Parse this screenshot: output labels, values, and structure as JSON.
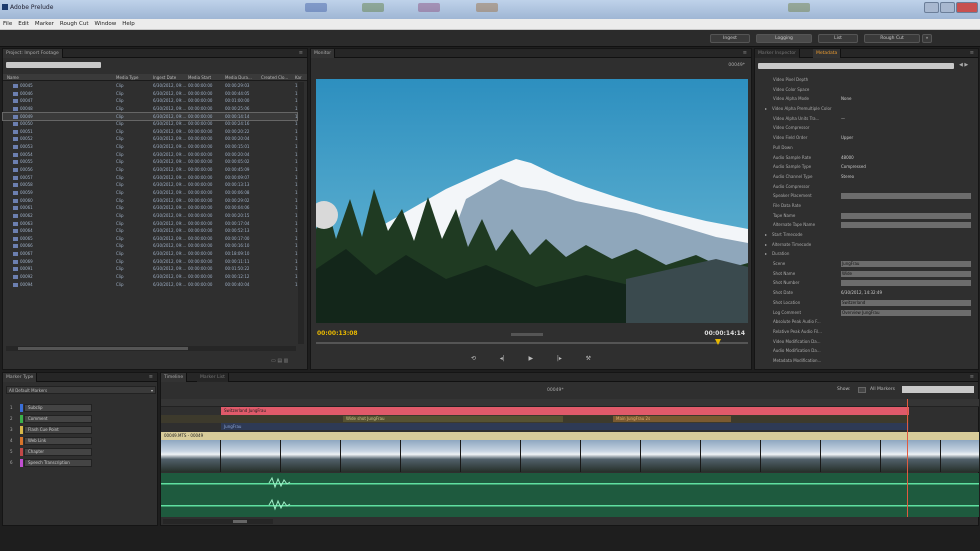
{
  "window": {
    "title": "Adobe Prelude",
    "menu": [
      "File",
      "Edit",
      "Marker",
      "Rough Cut",
      "Window",
      "Help"
    ]
  },
  "workspace": {
    "buttons": [
      "Ingest",
      "Logging",
      "List",
      "Rough Cut"
    ],
    "active": "Logging",
    "more": "»"
  },
  "project": {
    "tab": "Project: Import Footage",
    "menu_glyph": "≡",
    "columns": [
      "Name",
      "Media Type",
      "Ingest Date",
      "Media Start",
      "Media Dura...",
      "Created Clo...",
      "Kar"
    ],
    "rows": [
      {
        "name": "00045",
        "type": "Clip",
        "date": "6/30/2012, 09:...",
        "start": "00:00:00:00",
        "dur": "00:00:29:03"
      },
      {
        "name": "00046",
        "type": "Clip",
        "date": "6/30/2012, 09:...",
        "start": "00:00:00:00",
        "dur": "00:00:44:05"
      },
      {
        "name": "00047",
        "type": "Clip",
        "date": "6/30/2012, 09:...",
        "start": "00:00:00:00",
        "dur": "00:01:00:00"
      },
      {
        "name": "00048",
        "type": "Clip",
        "date": "6/30/2012, 09:...",
        "start": "00:00:00:00",
        "dur": "00:00:25:06"
      },
      {
        "name": "00049",
        "type": "Clip",
        "date": "6/30/2012, 09:...",
        "start": "00:00:00:00",
        "dur": "00:00:14:14"
      },
      {
        "name": "00050",
        "type": "Clip",
        "date": "6/30/2012, 09:...",
        "start": "00:00:00:00",
        "dur": "00:00:24:16"
      },
      {
        "name": "00051",
        "type": "Clip",
        "date": "6/30/2012, 09:...",
        "start": "00:00:00:00",
        "dur": "00:00:20:22"
      },
      {
        "name": "00052",
        "type": "Clip",
        "date": "6/30/2012, 09:...",
        "start": "00:00:00:00",
        "dur": "00:00:20:04"
      },
      {
        "name": "00053",
        "type": "Clip",
        "date": "6/30/2012, 09:...",
        "start": "00:00:00:00",
        "dur": "00:00:15:01"
      },
      {
        "name": "00054",
        "type": "Clip",
        "date": "6/30/2012, 09:...",
        "start": "00:00:00:00",
        "dur": "00:00:20:04"
      },
      {
        "name": "00055",
        "type": "Clip",
        "date": "6/30/2012, 09:...",
        "start": "00:00:00:00",
        "dur": "00:00:05:02"
      },
      {
        "name": "00056",
        "type": "Clip",
        "date": "6/30/2012, 09:...",
        "start": "00:00:00:00",
        "dur": "00:00:45:09"
      },
      {
        "name": "00057",
        "type": "Clip",
        "date": "6/30/2012, 09:...",
        "start": "00:00:00:00",
        "dur": "00:00:09:07"
      },
      {
        "name": "00058",
        "type": "Clip",
        "date": "6/30/2012, 09:...",
        "start": "00:00:00:00",
        "dur": "00:00:13:13"
      },
      {
        "name": "00059",
        "type": "Clip",
        "date": "6/30/2012, 09:...",
        "start": "00:00:00:00",
        "dur": "00:00:06:08"
      },
      {
        "name": "00060",
        "type": "Clip",
        "date": "6/30/2012, 09:...",
        "start": "00:00:00:00",
        "dur": "00:00:29:02"
      },
      {
        "name": "00061",
        "type": "Clip",
        "date": "6/30/2012, 09:...",
        "start": "00:00:00:00",
        "dur": "00:00:04:06"
      },
      {
        "name": "00062",
        "type": "Clip",
        "date": "6/30/2012, 09:...",
        "start": "00:00:00:00",
        "dur": "00:00:20:15"
      },
      {
        "name": "00063",
        "type": "Clip",
        "date": "6/30/2012, 09:...",
        "start": "00:00:00:00",
        "dur": "00:00:17:04"
      },
      {
        "name": "00064",
        "type": "Clip",
        "date": "6/30/2012, 09:...",
        "start": "00:00:00:00",
        "dur": "00:00:52:13"
      },
      {
        "name": "00065",
        "type": "Clip",
        "date": "6/30/2012, 09:...",
        "start": "00:00:00:00",
        "dur": "00:00:17:00"
      },
      {
        "name": "00066",
        "type": "Clip",
        "date": "6/30/2012, 09:...",
        "start": "00:00:00:00",
        "dur": "00:00:16:10"
      },
      {
        "name": "00067",
        "type": "Clip",
        "date": "6/30/2012, 09:...",
        "start": "00:00:00:00",
        "dur": "00:18:09:10"
      },
      {
        "name": "00069",
        "type": "Clip",
        "date": "6/30/2012, 09:...",
        "start": "00:00:00:00",
        "dur": "00:00:11:11"
      },
      {
        "name": "00091",
        "type": "Clip",
        "date": "6/30/2012, 09:...",
        "start": "00:00:00:00",
        "dur": "00:01:50:22"
      },
      {
        "name": "00092",
        "type": "Clip",
        "date": "6/30/2012, 09:...",
        "start": "00:00:00:00",
        "dur": "00:00:12:12"
      },
      {
        "name": "00094",
        "type": "Clip",
        "date": "6/30/2012, 09:...",
        "start": "00:00:00:00",
        "dur": "00:00:40:04"
      }
    ],
    "kar_value": "1",
    "selected_index": 4
  },
  "monitor": {
    "tab": "Monitor",
    "clip_name": "00049*",
    "current_tc": "00:00:13:08",
    "duration_tc": "00:00:14:14",
    "timeline_progress": 0.93
  },
  "metadata": {
    "tabs": [
      "Marker Inspector",
      "Metadata"
    ],
    "active": "Metadata",
    "rows": [
      {
        "label": "Video Pixel Depth",
        "value": ""
      },
      {
        "label": "Video Color Space",
        "value": ""
      },
      {
        "label": "Video Alpha Mode",
        "value": "None"
      },
      {
        "label": "Video Alpha Premultiple Color",
        "value": "",
        "arrow": "▸"
      },
      {
        "label": "Video Alpha Units Tra...",
        "value": "—"
      },
      {
        "label": "Video Compressor",
        "value": ""
      },
      {
        "label": "Video Field Order",
        "value": "Upper"
      },
      {
        "label": "Pull Down",
        "value": ""
      },
      {
        "label": "Audio Sample Rate",
        "value": "48000"
      },
      {
        "label": "Audio Sample Type",
        "value": "Compressed"
      },
      {
        "label": "Audio Channel Type",
        "value": "Stereo"
      },
      {
        "label": "Audio Compressor",
        "value": ""
      },
      {
        "label": "Speaker Placement",
        "value": "",
        "box": true
      },
      {
        "label": "File Data Rate",
        "value": ""
      },
      {
        "label": "Tape Name",
        "value": "",
        "box": true
      },
      {
        "label": "Alternate Tape Name",
        "value": "",
        "box": true
      },
      {
        "label": "Start Timecode",
        "value": "",
        "arrow": "▸"
      },
      {
        "label": "Alternate Timecode",
        "value": "",
        "arrow": "▸"
      },
      {
        "label": "Duration",
        "value": "",
        "arrow": "▸"
      },
      {
        "label": "Scene",
        "value": "JungFrau",
        "box": true
      },
      {
        "label": "Shot Name",
        "value": "Wide",
        "box": true
      },
      {
        "label": "Shot Number",
        "value": "",
        "box": true
      },
      {
        "label": "Shot Date",
        "value": "6/30/2012, 14:32:49"
      },
      {
        "label": "Shot Location",
        "value": "Switzerland",
        "box": true
      },
      {
        "label": "Log Comment",
        "value": "Overview JungFrau",
        "box": true
      },
      {
        "label": "Absolute Peak Audio F...",
        "value": ""
      },
      {
        "label": "Relative Peak Audio Fil...",
        "value": ""
      },
      {
        "label": "Video Modification Da...",
        "value": ""
      },
      {
        "label": "Audio Modification Da...",
        "value": ""
      },
      {
        "label": "Metadata Modification...",
        "value": ""
      }
    ]
  },
  "marker_type": {
    "tab": "Marker Type",
    "dropdown": "All Default Markers",
    "items": [
      {
        "num": "1",
        "name": "Subclip",
        "color": "#3a6fd8"
      },
      {
        "num": "2",
        "name": "Comment",
        "color": "#3bb04a"
      },
      {
        "num": "3",
        "name": "Flash Cue Point",
        "color": "#d8b84a"
      },
      {
        "num": "4",
        "name": "Web Link",
        "color": "#d8742a"
      },
      {
        "num": "5",
        "name": "Chapter",
        "color": "#c24848"
      },
      {
        "num": "6",
        "name": "Speech Transcription",
        "color": "#c04fd0"
      }
    ]
  },
  "timeline": {
    "tabs": [
      "Timeline",
      "Marker List"
    ],
    "clip_label": "00049*",
    "show_label": "Show:",
    "show_value": "All Markers",
    "subclip_label": "Switzerland JungFrau",
    "comment_label": "Wide shot JungFrau",
    "comment_label2": "Main JungFrau 2s",
    "chapter_label": "JungFrau",
    "track_label": "00049.MTS - 00049",
    "playhead": 0.912
  }
}
